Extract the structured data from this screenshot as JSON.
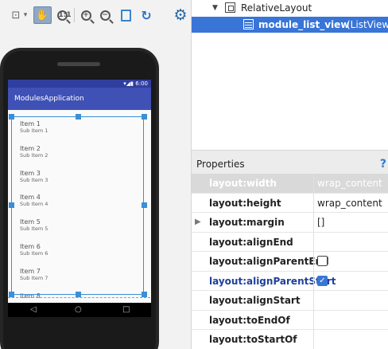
{
  "device": {
    "status_time": "6:00",
    "app_title": "ModulesApplication",
    "list_items": [
      {
        "title": "Item 1",
        "sub": "Sub Item 1"
      },
      {
        "title": "Item 2",
        "sub": "Sub Item 2"
      },
      {
        "title": "Item 3",
        "sub": "Sub Item 3"
      },
      {
        "title": "Item 4",
        "sub": "Sub Item 4"
      },
      {
        "title": "Item 5",
        "sub": "Sub Item 5"
      },
      {
        "title": "Item 6",
        "sub": "Sub Item 6"
      },
      {
        "title": "Item 7",
        "sub": "Sub Item 7"
      },
      {
        "title": "Item 8",
        "sub": ""
      }
    ],
    "nav": {
      "back": "◁",
      "home": "○",
      "recents": "□"
    }
  },
  "toolbar": {
    "icons": [
      "zoom-fit-icon",
      "chevron-down-icon",
      "pan-mode-icon",
      "actual-size-icon",
      "zoom-in-icon",
      "zoom-out-icon",
      "page-icon",
      "refresh-icon",
      "settings-gear-icon"
    ],
    "actual_size_label": "1:1",
    "zoom_in_label": "+",
    "zoom_out_label": "−"
  },
  "tree": {
    "root_label": "RelativeLayout",
    "child_id": "module_list_view",
    "child_type": "(ListView)"
  },
  "properties": {
    "title": "Properties",
    "help": "?",
    "rows": [
      {
        "name": "layout:width",
        "value": "wrap_content"
      },
      {
        "name": "layout:height",
        "value": "wrap_content"
      },
      {
        "name": "layout:margin",
        "value": "[]"
      },
      {
        "name": "layout:alignEnd",
        "value": ""
      },
      {
        "name": "layout:alignParentEnd",
        "value": ""
      },
      {
        "name": "layout:alignParentStart",
        "value": ""
      },
      {
        "name": "layout:alignStart",
        "value": ""
      },
      {
        "name": "layout:toEndOf",
        "value": ""
      },
      {
        "name": "layout:toStartOf",
        "value": ""
      }
    ],
    "align_parent_end_checked": false,
    "align_parent_start_checked": true
  },
  "colors": {
    "selection": "#3875d7",
    "app_bar": "#3f51b5",
    "status_bar": "#303f9f",
    "selection_frame": "#3a8fd8"
  }
}
